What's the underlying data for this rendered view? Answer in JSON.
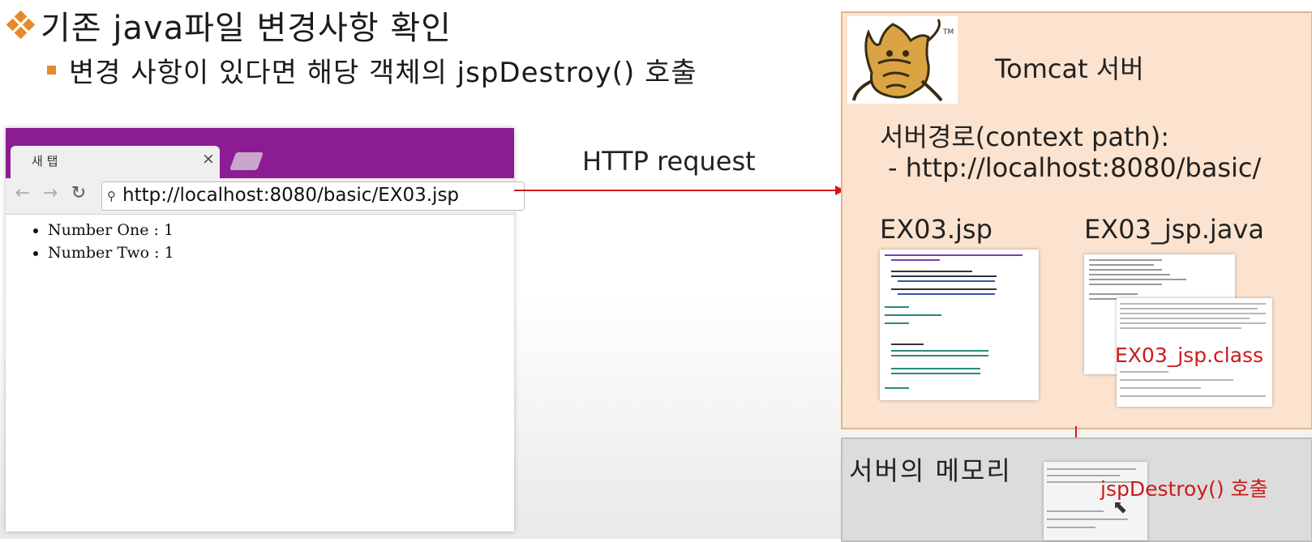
{
  "slide": {
    "title": "기존 java파일 변경사항 확인",
    "bullet": "변경 사항이 있다면 해당 객체의 jspDestroy() 호출"
  },
  "browser": {
    "tab_label": "새 탭",
    "tab_close": "×",
    "url": "http://localhost:8080/basic/EX03.jsp",
    "content": [
      "Number One : 1",
      "Number Two : 1"
    ]
  },
  "request_label": "HTTP request",
  "server": {
    "title": "Tomcat 서버",
    "logo_mark": "TM",
    "context_label": "서버경로(context path):",
    "context_url": "- http://localhost:8080/basic/",
    "jsp_file": "EX03.jsp",
    "java_file": "EX03_jsp.java",
    "class_file": "EX03_jsp.class"
  },
  "memory": {
    "label": "서버의 메모리",
    "call": "jspDestroy() 호출"
  },
  "colors": {
    "accent_orange": "#e58a2b",
    "browser_purple": "#8c1c91",
    "arrow_red": "#d41a1a",
    "server_bg": "#fbe3cf",
    "memory_bg": "#dcdcdc"
  }
}
